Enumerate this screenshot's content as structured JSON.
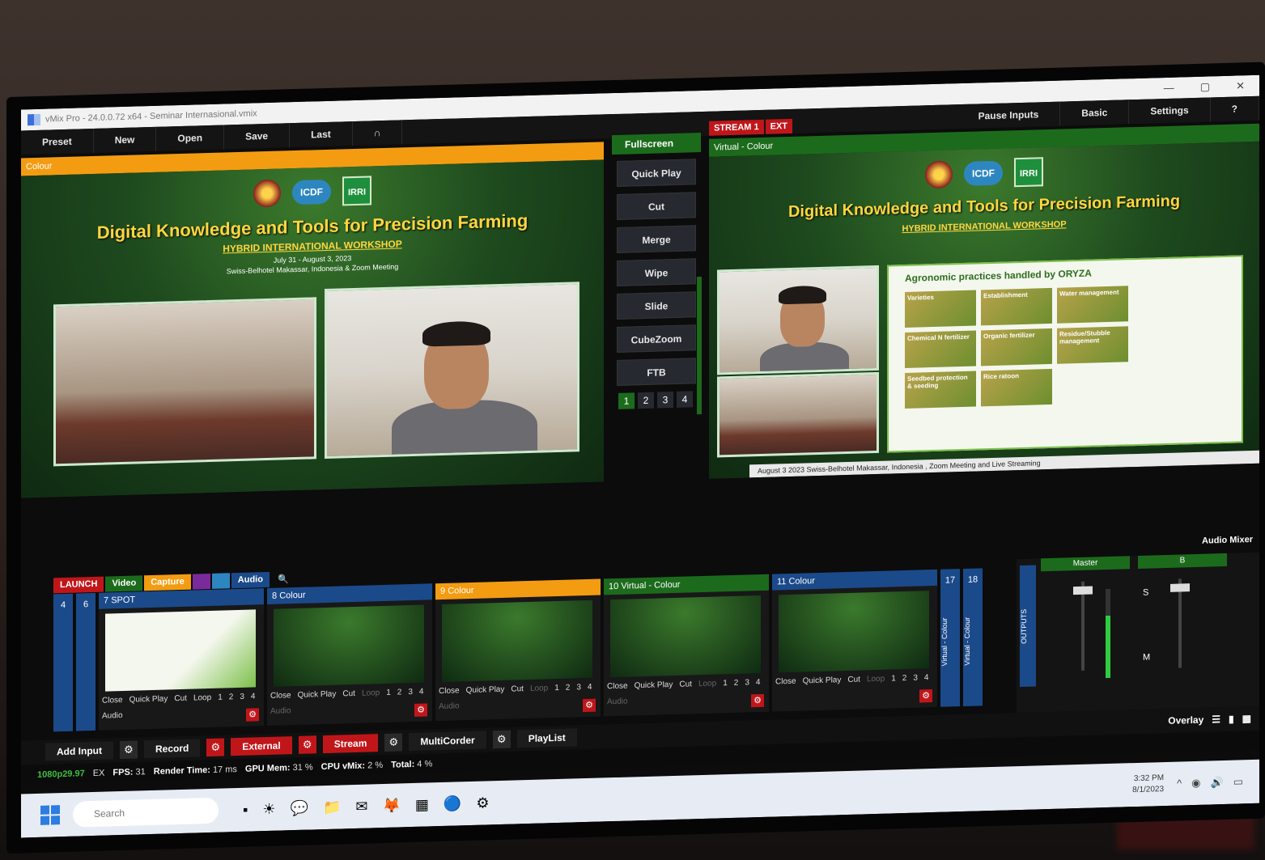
{
  "window": {
    "title": "vMix Pro - 24.0.0.72 x64 - Seminar Internasional.vmix",
    "minimize": "—",
    "maximize": "▢",
    "close": "✕"
  },
  "toolbar": {
    "preset": "Preset",
    "new": "New",
    "open": "Open",
    "save": "Save",
    "last": "Last",
    "pause_inputs": "Pause Inputs",
    "basic": "Basic",
    "settings": "Settings",
    "help": "?"
  },
  "preview": {
    "label": "Colour"
  },
  "program": {
    "label": "Virtual - Colour"
  },
  "stream": {
    "stream_label": "STREAM 1",
    "ext_label": "EXT"
  },
  "workshop": {
    "title": "Digital Knowledge and Tools for Precision Farming",
    "subtitle": "HYBRID INTERNATIONAL WORKSHOP",
    "date": "July 31 - August 3, 2023",
    "venue": "Swiss-Belhotel Makassar, Indonesia & Zoom Meeting",
    "logo_icdf": "ICDF",
    "logo_irri": "IRRI"
  },
  "agro": {
    "title": "Agronomic practices handled by ORYZA",
    "cells": [
      "Varieties",
      "Establishment",
      "Water management",
      "Chemical N fertilizer",
      "Organic fertilizer",
      "Residue/Stubble management",
      "Seedbed protection & seeding",
      "Rice ratoon",
      ""
    ]
  },
  "ticker": "August 3 2023 Swiss-Belhotel Makassar, Indonesia , Zoom Meeting and Live Streaming",
  "transitions": {
    "fullscreen": "Fullscreen",
    "buttons": [
      "Quick Play",
      "Cut",
      "Merge",
      "Wipe",
      "Slide",
      "CubeZoom",
      "FTB"
    ],
    "numbers": [
      "1",
      "2",
      "3",
      "4"
    ]
  },
  "tabs": {
    "launch": "LAUNCH",
    "video": "Video",
    "capture": "Capture",
    "audio": "Audio"
  },
  "inputs": {
    "side_numbers": [
      "4",
      "6"
    ],
    "tiles": [
      {
        "num": "7",
        "name": "SPOT",
        "color": "#1b4a8a"
      },
      {
        "num": "8",
        "name": "Colour",
        "color": "#1b4a8a"
      },
      {
        "num": "9",
        "name": "Colour",
        "color": "#f39c12"
      },
      {
        "num": "10",
        "name": "Virtual - Colour",
        "color": "#1c6b1c"
      },
      {
        "num": "11",
        "name": "Colour",
        "color": "#1b4a8a"
      }
    ],
    "extra": [
      "17",
      "18"
    ],
    "ctrl": {
      "close": "Close",
      "quick_play": "Quick Play",
      "cut": "Cut",
      "loop": "Loop",
      "audio": "Audio",
      "n1": "1",
      "n2": "2",
      "n3": "3",
      "n4": "4"
    },
    "vertical_labels": [
      "Virtual - Colour",
      "Virtual - Colour"
    ]
  },
  "audio_mixer": {
    "label": "Audio Mixer",
    "outputs": "OUTPUTS",
    "master": "Master",
    "bus_b": "B",
    "s": "S",
    "m": "M"
  },
  "bottombar": {
    "add_input": "Add Input",
    "record": "Record",
    "external": "External",
    "stream": "Stream",
    "multicorder": "MultiCorder",
    "playlist": "PlayList",
    "overlay": "Overlay"
  },
  "status": {
    "resolution": "1080p29.97",
    "ex": "EX",
    "fps_label": "FPS:",
    "fps": "31",
    "render_label": "Render Time:",
    "render": "17 ms",
    "gpu_label": "GPU Mem:",
    "gpu": "31 %",
    "cpu_label": "CPU vMix:",
    "cpu": "2 %",
    "total_label": "Total:",
    "total": "4 %"
  },
  "taskbar": {
    "search_placeholder": "Search",
    "time": "3:32 PM",
    "date": "8/1/2023"
  },
  "colors": {
    "accent_green": "#1c6b1c",
    "accent_orange": "#f39c12",
    "accent_red": "#c0161a",
    "accent_blue": "#1b4a8a",
    "title_yellow": "#ffd640"
  }
}
